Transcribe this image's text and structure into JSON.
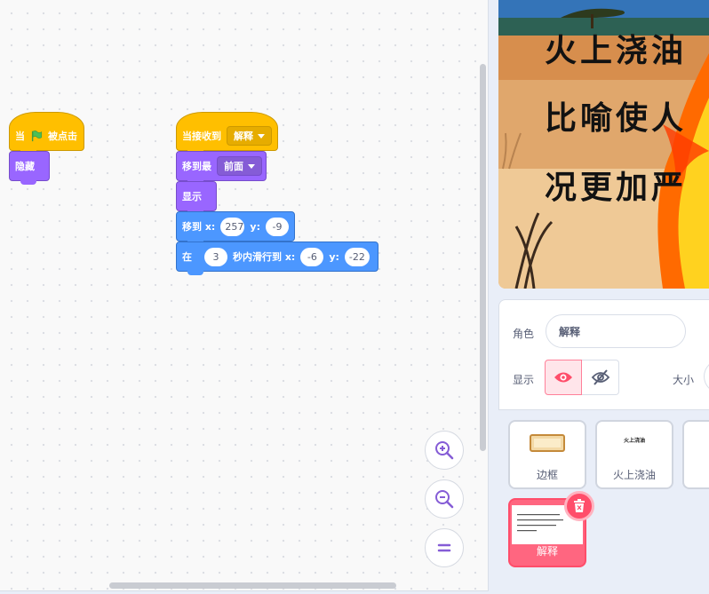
{
  "script1": {
    "hat_prefix": "当",
    "hat_suffix": "被点击",
    "hide": "隐藏"
  },
  "script2": {
    "hat_label": "当接收到",
    "hat_message": "解释",
    "goto_layer_label": "移到最",
    "goto_layer_value": "前面",
    "show": "显示",
    "goto_label": "移到 x:",
    "goto_x": "257",
    "goto_y_label": "y:",
    "goto_y": "-9",
    "glide_prefix": "在",
    "glide_secs": "3",
    "glide_mid": "秒内滑行到 x:",
    "glide_x": "-6",
    "glide_y_label": "y:",
    "glide_y": "-22"
  },
  "stage": {
    "lines": [
      "火上浇油",
      "比喻使人",
      "况更加严"
    ]
  },
  "sprite_info": {
    "sprite_label": "角色",
    "sprite_name": "解释",
    "show_label": "显示",
    "size_label": "大小"
  },
  "sprites": [
    {
      "name": "边框"
    },
    {
      "name": "火上浇油",
      "thumb_text": "火上浇油"
    },
    {
      "name": "解释",
      "selected": true
    }
  ],
  "colors": {
    "events": "#ffbf00",
    "looks": "#9966ff",
    "motion": "#4c97ff",
    "selected_sprite": "#ff6680"
  }
}
